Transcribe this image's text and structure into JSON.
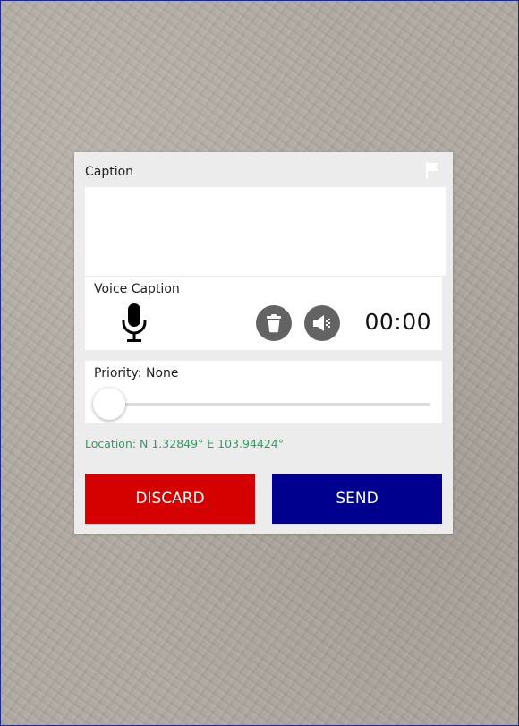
{
  "caption": {
    "label": "Caption",
    "value": ""
  },
  "voice_caption": {
    "label": "Voice Caption",
    "timer": "00:00",
    "icons": [
      "microphone-icon",
      "trash-icon",
      "speaker-icon"
    ]
  },
  "priority": {
    "label": "Priority: None",
    "slider_value": 0
  },
  "location": {
    "text": "Location: N 1.32849° E 103.94424°"
  },
  "buttons": {
    "discard_label": "DISCARD",
    "send_label": "SEND"
  },
  "colors": {
    "discard": "#d50000",
    "send": "#00008f",
    "location_text": "#2aa060",
    "icon_circle": "#636363"
  }
}
